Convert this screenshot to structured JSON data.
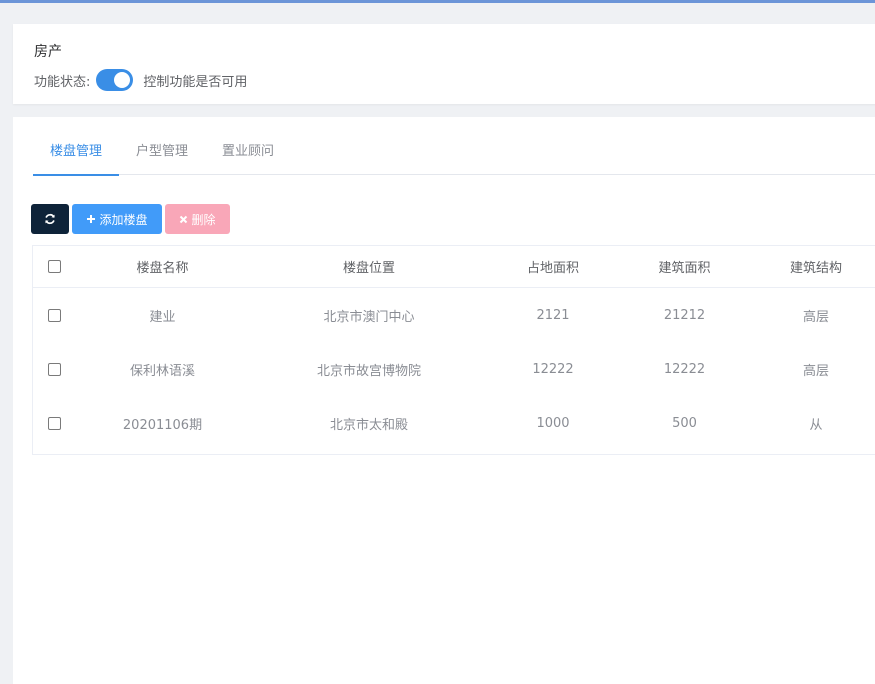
{
  "module": {
    "title": "房产",
    "status_label": "功能状态:",
    "toggle_on": true,
    "toggle_description": "控制功能是否可用"
  },
  "tabs": [
    {
      "label": "楼盘管理",
      "active": true
    },
    {
      "label": "户型管理",
      "active": false
    },
    {
      "label": "置业顾问",
      "active": false
    }
  ],
  "toolbar": {
    "refresh_icon": "refresh-icon",
    "add_label": "添加楼盘",
    "add_icon": "plus-icon",
    "delete_label": "删除",
    "delete_icon": "close-icon"
  },
  "table": {
    "headers": [
      "楼盘名称",
      "楼盘位置",
      "占地面积",
      "建筑面积",
      "建筑结构"
    ],
    "rows": [
      [
        "建业",
        "北京市澳门中心",
        "2121",
        "21212",
        "高层"
      ],
      [
        "保利林语溪",
        "北京市故宫博物院",
        "12222",
        "12222",
        "高层"
      ],
      [
        "20201106期",
        "北京市太和殿",
        "1000",
        "500",
        "从"
      ]
    ]
  },
  "colors": {
    "accent": "#3a8ee6",
    "refresh_button": "#0e2339",
    "add_button": "#419bf9",
    "delete_button": "#f9a7b8"
  }
}
